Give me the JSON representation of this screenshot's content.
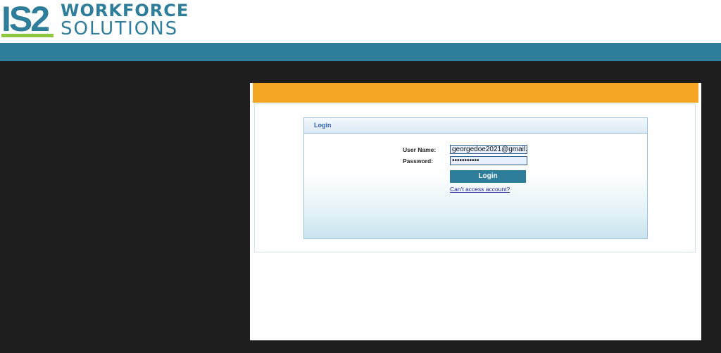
{
  "header": {
    "logo": {
      "mark": "IS2",
      "line1": "WORKFORCE",
      "line2": "SOLUTIONS"
    }
  },
  "login": {
    "title": "Login",
    "username_label": "User Name:",
    "username_value": "georgedoe2021@gmail.c",
    "password_label": "Password:",
    "password_value": "•••••••••••",
    "button_label": "Login",
    "forgot_link": "Can't access account?"
  },
  "colors": {
    "brand_teal": "#2e7d9a",
    "brand_green": "#8dc63f",
    "accent_orange": "#f5a623",
    "background_dark": "#1e1e1e"
  }
}
